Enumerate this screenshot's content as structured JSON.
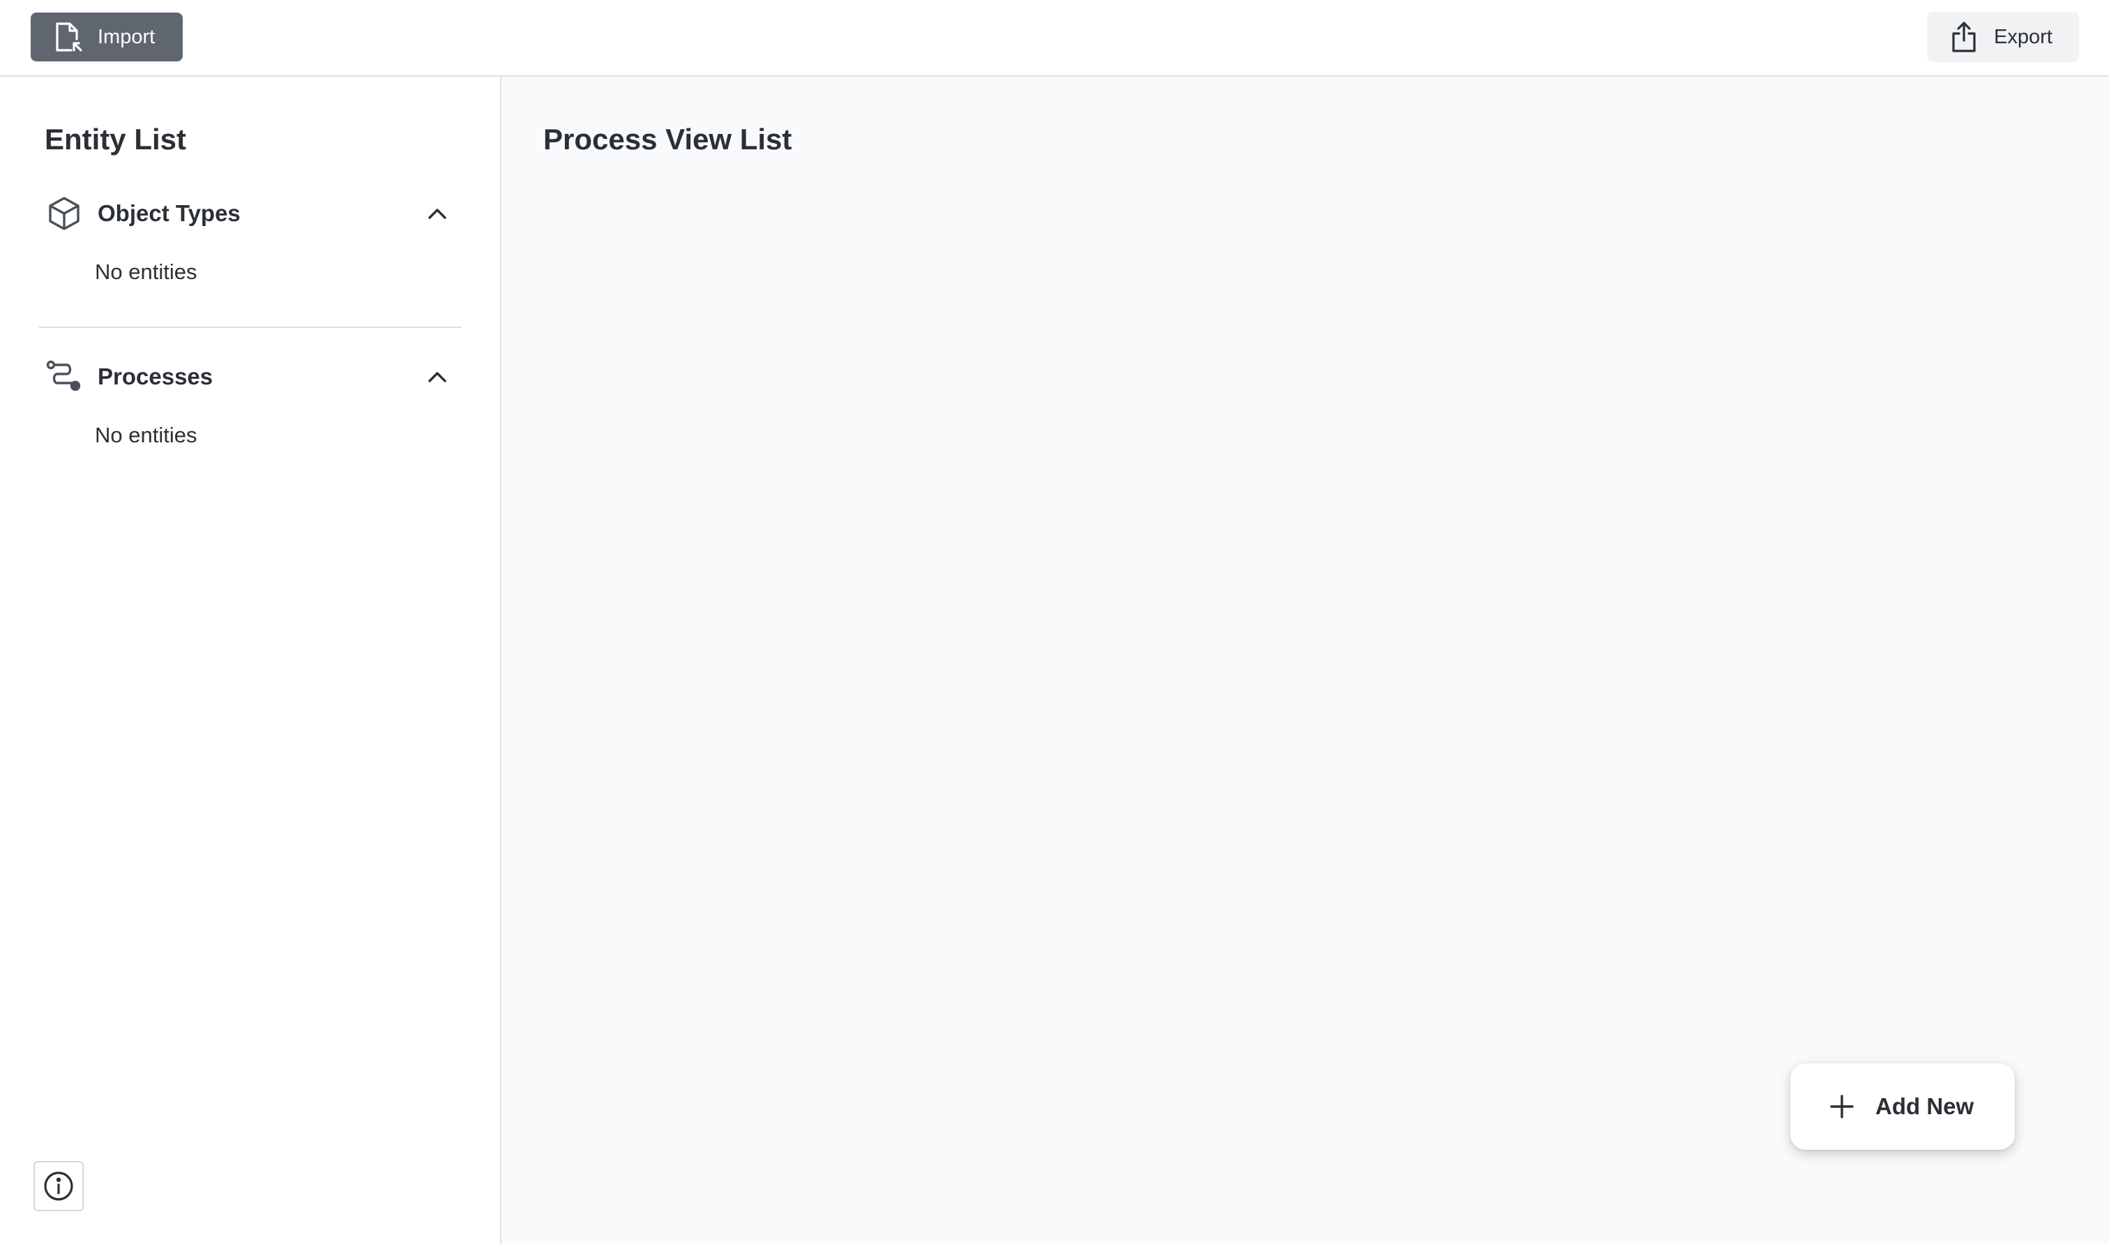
{
  "toolbar": {
    "import_label": "Import",
    "import_icon": "file-import-icon",
    "export_label": "Export",
    "export_icon": "share-export-icon"
  },
  "sidebar": {
    "title": "Entity List",
    "sections": [
      {
        "label": "Object Types",
        "icon": "cube-icon",
        "expanded": true,
        "empty_text": "No entities"
      },
      {
        "label": "Processes",
        "icon": "route-icon",
        "expanded": true,
        "empty_text": "No entities"
      }
    ],
    "info_icon": "info-icon"
  },
  "main": {
    "title": "Process View List",
    "add_label": "Add New",
    "add_icon": "plus-icon"
  },
  "colors": {
    "import_button_bg": "#5f6670",
    "export_button_bg": "#f1f2f4",
    "main_bg": "#f9fafb",
    "text": "#2b2f36",
    "border": "#dcdfe3"
  }
}
